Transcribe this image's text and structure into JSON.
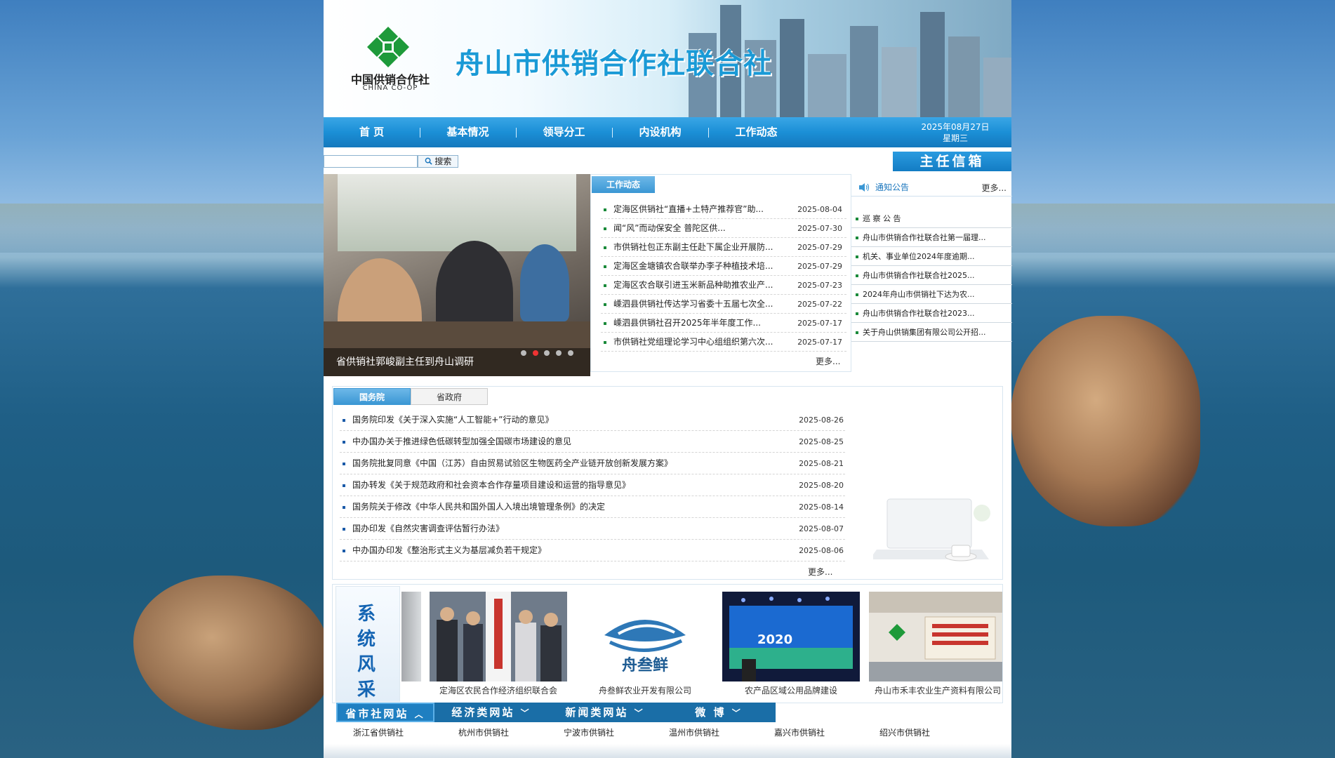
{
  "header": {
    "site_title": "舟山市供销合作社联合社",
    "logo_cn": "中国供销合作社",
    "logo_en": "CHINA CO-OP",
    "accent": "#1a9ad6"
  },
  "nav": {
    "items": [
      "首  页",
      "基本情况",
      "领导分工",
      "内设机构",
      "工作动态"
    ],
    "date": "2025年08月27日",
    "weekday": "星期三"
  },
  "search": {
    "value": "",
    "button_label": "搜索",
    "mail_label": "主任信箱"
  },
  "slideshow": {
    "caption": "省供销社郭峻副主任到舟山调研",
    "active_dot": 2,
    "dot_count": 5
  },
  "work_news": {
    "tab_label": "工作动态",
    "more_label": "更多...",
    "items": [
      {
        "title": "定海区供销社“直播+土特产推荐官”助...",
        "date": "2025-08-04"
      },
      {
        "title": "闻“风”而动保安全  普陀区供...",
        "date": "2025-07-30"
      },
      {
        "title": "市供销社包正东副主任赴下属企业开展防...",
        "date": "2025-07-29"
      },
      {
        "title": "定海区金塘镇农合联举办李子种植技术培...",
        "date": "2025-07-29"
      },
      {
        "title": "定海区农合联引进玉米新品种助推农业产...",
        "date": "2025-07-23"
      },
      {
        "title": "嵊泗县供销社传达学习省委十五届七次全...",
        "date": "2025-07-22"
      },
      {
        "title": "嵊泗县供销社召开2025年半年度工作...",
        "date": "2025-07-17"
      },
      {
        "title": "市供销社党组理论学习中心组组织第六次...",
        "date": "2025-07-17"
      }
    ]
  },
  "notices": {
    "title": "通知公告",
    "more_label": "更多...",
    "items": [
      "巡 察 公 告",
      "舟山市供销合作社联合社第一届理...",
      "机关、事业单位2024年度逾期...",
      "舟山市供销合作社联合社2025...",
      "2024年舟山市供销社下达为农...",
      "舟山市供销合作社联合社2023...",
      "关于舟山供销集团有限公司公开招..."
    ]
  },
  "national_news": {
    "tabs": [
      "国务院",
      "省政府"
    ],
    "more_label": "更多...",
    "items": [
      {
        "title": "国务院印发《关于深入实施“人工智能+”行动的意见》",
        "date": "2025-08-26"
      },
      {
        "title": "中办国办关于推进绿色低碳转型加强全国碳市场建设的意见",
        "date": "2025-08-25"
      },
      {
        "title": "国务院批复同意《中国（江苏）自由贸易试验区生物医药全产业链开放创新发展方案》",
        "date": "2025-08-21"
      },
      {
        "title": "国办转发《关于规范政府和社会资本合作存量项目建设和运营的指导意见》",
        "date": "2025-08-20"
      },
      {
        "title": "国务院关于修改《中华人民共和国外国人入境出境管理条例》的决定",
        "date": "2025-08-14"
      },
      {
        "title": "国办印发《自然灾害调查评估暂行办法》",
        "date": "2025-08-07"
      },
      {
        "title": "中办国办印发《整治形式主义为基层减负若干规定》",
        "date": "2025-08-06"
      }
    ]
  },
  "gallery": {
    "label": [
      "系",
      "统",
      "风",
      "采"
    ],
    "items": [
      {
        "caption": "定海区农民合作经济组织联合会",
        "icon": "photo-ceremony"
      },
      {
        "caption": "舟叁鲜农业开发有限公司",
        "icon": "fish-logo",
        "logo_text": "舟叁鲜"
      },
      {
        "caption": "农产品区域公用品牌建设",
        "icon": "photo-stage",
        "stage_text": "2020"
      },
      {
        "caption": "舟山市禾丰农业生产资料有限公司",
        "icon": "photo-office"
      }
    ]
  },
  "links": {
    "tabs": [
      {
        "label": "省市社网站",
        "active": true
      },
      {
        "label": "经济类网站",
        "active": false
      },
      {
        "label": "新闻类网站",
        "active": false
      },
      {
        "label": "微    博",
        "active": false
      }
    ],
    "items": [
      "浙江省供销社",
      "杭州市供销社",
      "宁波市供销社",
      "温州市供销社",
      "嘉兴市供销社",
      "绍兴市供销社"
    ]
  }
}
